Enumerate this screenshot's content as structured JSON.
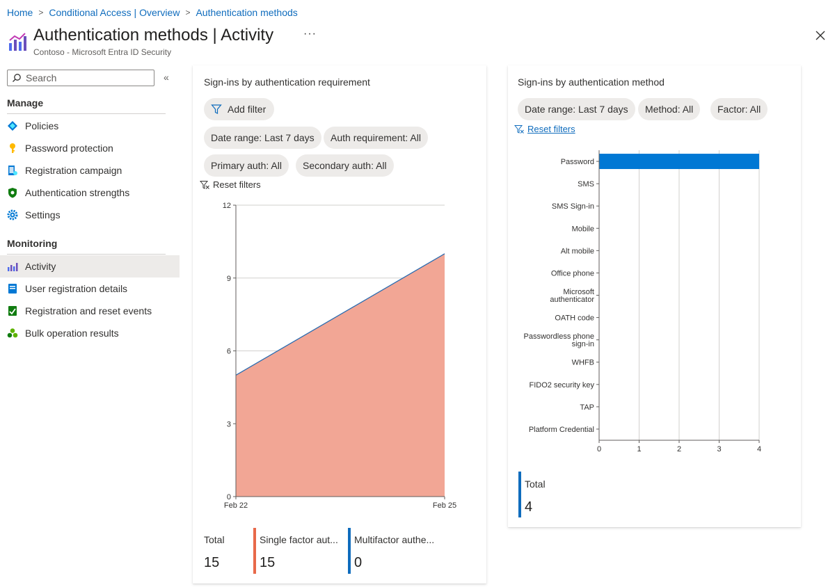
{
  "breadcrumb": [
    "Home",
    "Conditional Access | Overview",
    "Authentication methods"
  ],
  "page": {
    "title": "Authentication methods | Activity",
    "subtitle": "Contoso - Microsoft Entra ID Security",
    "more_label": "···"
  },
  "sidebar": {
    "search_placeholder": "Search",
    "collapse_label": "«",
    "manage_heading": "Manage",
    "manage_items": [
      {
        "label": "Policies",
        "icon": "policies-icon"
      },
      {
        "label": "Password protection",
        "icon": "key-icon"
      },
      {
        "label": "Registration campaign",
        "icon": "campaign-icon"
      },
      {
        "label": "Authentication strengths",
        "icon": "shield-icon"
      },
      {
        "label": "Settings",
        "icon": "gear-icon"
      }
    ],
    "monitoring_heading": "Monitoring",
    "monitoring_items": [
      {
        "label": "Activity",
        "icon": "activity-icon",
        "active": true
      },
      {
        "label": "User registration details",
        "icon": "user-details-icon"
      },
      {
        "label": "Registration and reset events",
        "icon": "events-icon"
      },
      {
        "label": "Bulk operation results",
        "icon": "bulk-icon"
      }
    ]
  },
  "left_card": {
    "title": "Sign-ins by authentication requirement",
    "add_filter": "Add filter",
    "filters": [
      "Date range: Last 7 days",
      "Auth requirement: All",
      "Primary auth: All",
      "Secondary auth: All"
    ],
    "reset": "Reset filters",
    "stats": [
      {
        "label": "Total",
        "value": "15"
      },
      {
        "label": "Single factor aut...",
        "value": "15"
      },
      {
        "label": "Multifactor authe...",
        "value": "0"
      }
    ]
  },
  "right_card": {
    "title": "Sign-ins by authentication method",
    "filters": [
      "Date range: Last 7 days",
      "Method: All",
      "Factor: All"
    ],
    "reset": "Reset filters",
    "stats": [
      {
        "label": "Total",
        "value": "4"
      }
    ]
  },
  "colors": {
    "accent": "#0f6cbd",
    "single_factor": "#e8694a",
    "single_factor_fill": "#f2a695",
    "multifactor": "#0f6cbd",
    "bar": "#0078d4"
  },
  "chart_data": [
    {
      "type": "area",
      "x": [
        "Feb 22",
        "Feb 25"
      ],
      "series": [
        {
          "values": [
            5,
            10
          ],
          "fill": "#f2a695",
          "line": "#2b6cb0"
        }
      ],
      "ylim": [
        0,
        12
      ],
      "yticks": [
        0,
        3,
        6,
        9,
        12
      ],
      "grid": true
    },
    {
      "type": "bar",
      "orientation": "horizontal",
      "categories": [
        "Password",
        "SMS",
        "SMS Sign-in",
        "Mobile",
        "Alt mobile",
        "Office phone",
        "Microsoft authenticator",
        "OATH code",
        "Passwordless phone sign-in",
        "WHFB",
        "FIDO2 security key",
        "TAP",
        "Platform Credential"
      ],
      "category_lines": [
        [
          "Password"
        ],
        [
          "SMS"
        ],
        [
          "SMS Sign-in"
        ],
        [
          "Mobile"
        ],
        [
          "Alt mobile"
        ],
        [
          "Office phone"
        ],
        [
          "Microsoft",
          "authenticator"
        ],
        [
          "OATH code"
        ],
        [
          "Passwordless phone",
          "sign-in"
        ],
        [
          "WHFB"
        ],
        [
          "FIDO2 security key"
        ],
        [
          "TAP"
        ],
        [
          "Platform Credential"
        ]
      ],
      "values": [
        4,
        0,
        0,
        0,
        0,
        0,
        0,
        0,
        0,
        0,
        0,
        0,
        0
      ],
      "xlim": [
        0,
        4
      ],
      "xticks": [
        0,
        1,
        2,
        3,
        4
      ],
      "grid": true
    }
  ]
}
